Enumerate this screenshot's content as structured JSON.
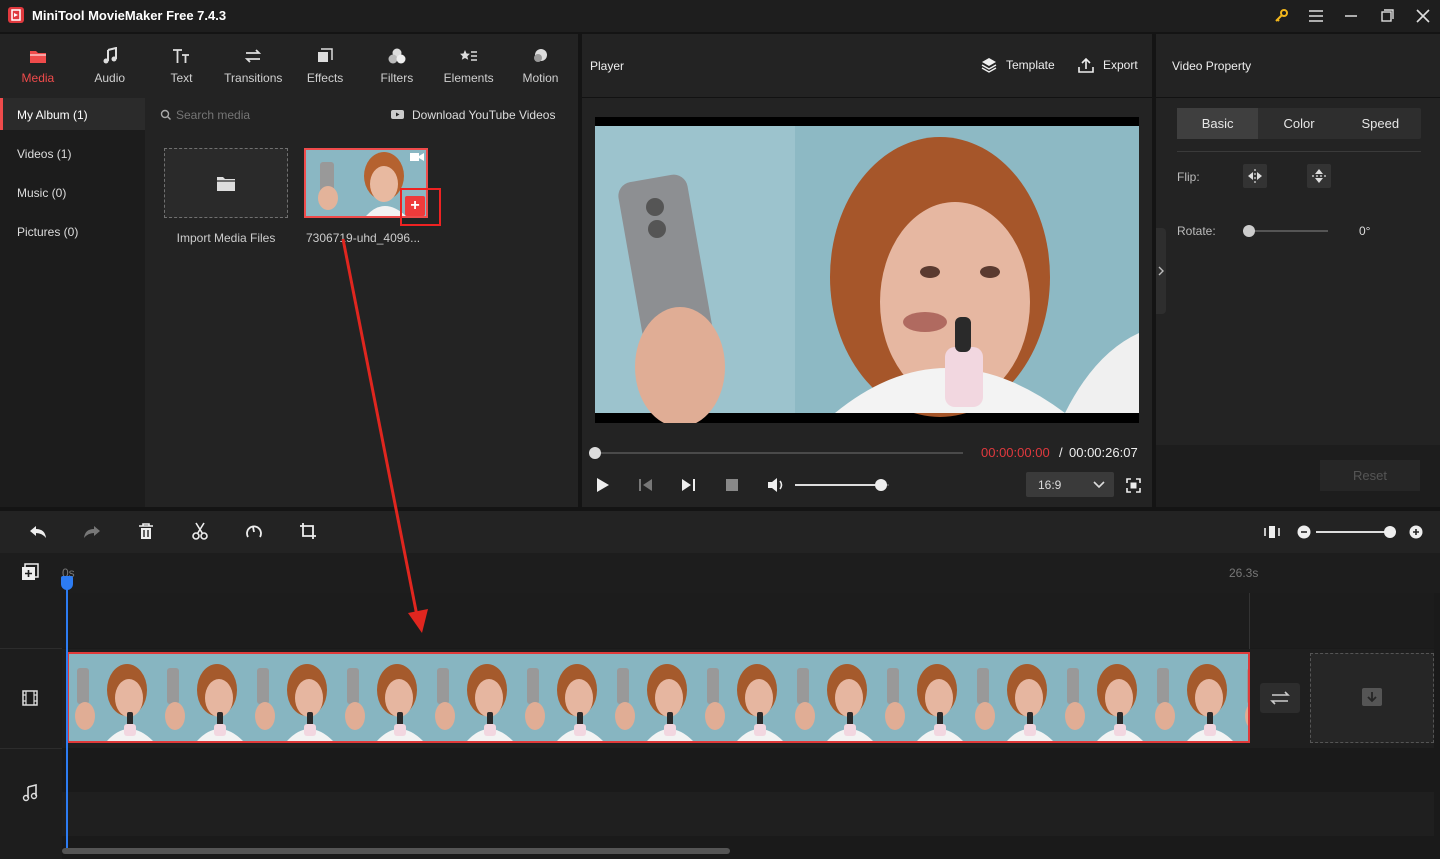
{
  "app": {
    "title": "MiniTool MovieMaker Free 7.4.3"
  },
  "toolbar": {
    "tabs": [
      {
        "label": "Media",
        "icon": "folder-icon",
        "active": true
      },
      {
        "label": "Audio",
        "icon": "music-note-icon"
      },
      {
        "label": "Text",
        "icon": "text-icon"
      },
      {
        "label": "Transitions",
        "icon": "transitions-icon"
      },
      {
        "label": "Effects",
        "icon": "effects-icon"
      },
      {
        "label": "Filters",
        "icon": "filters-icon"
      },
      {
        "label": "Elements",
        "icon": "elements-icon"
      },
      {
        "label": "Motion",
        "icon": "motion-icon"
      }
    ]
  },
  "sidebar": {
    "items": [
      {
        "label": "My Album (1)"
      },
      {
        "label": "Videos (1)"
      },
      {
        "label": "Music (0)"
      },
      {
        "label": "Pictures (0)"
      }
    ]
  },
  "media": {
    "search_placeholder": "Search media",
    "download_label": "Download YouTube Videos",
    "import_label": "Import Media Files",
    "file_name": "7306719-uhd_4096..."
  },
  "player": {
    "title": "Player",
    "template_label": "Template",
    "export_label": "Export",
    "current_time": "00:00:00:00",
    "separator": "/",
    "total_time": "00:00:26:07",
    "aspect_ratio": "16:9",
    "volume_level": 0.85,
    "progress": 0
  },
  "property": {
    "title": "Video Property",
    "tabs": [
      "Basic",
      "Color",
      "Speed"
    ],
    "active_tab": "Basic",
    "flip_label": "Flip:",
    "rotate_label": "Rotate:",
    "rotate_value": "0°",
    "reset_label": "Reset"
  },
  "timeline": {
    "start_label": "0s",
    "end_label": "26.3s",
    "zoom_level": 1.0
  },
  "colors": {
    "accent": "#ef4b4b",
    "playhead": "#2d7cf2",
    "time_current": "#e0393e"
  }
}
